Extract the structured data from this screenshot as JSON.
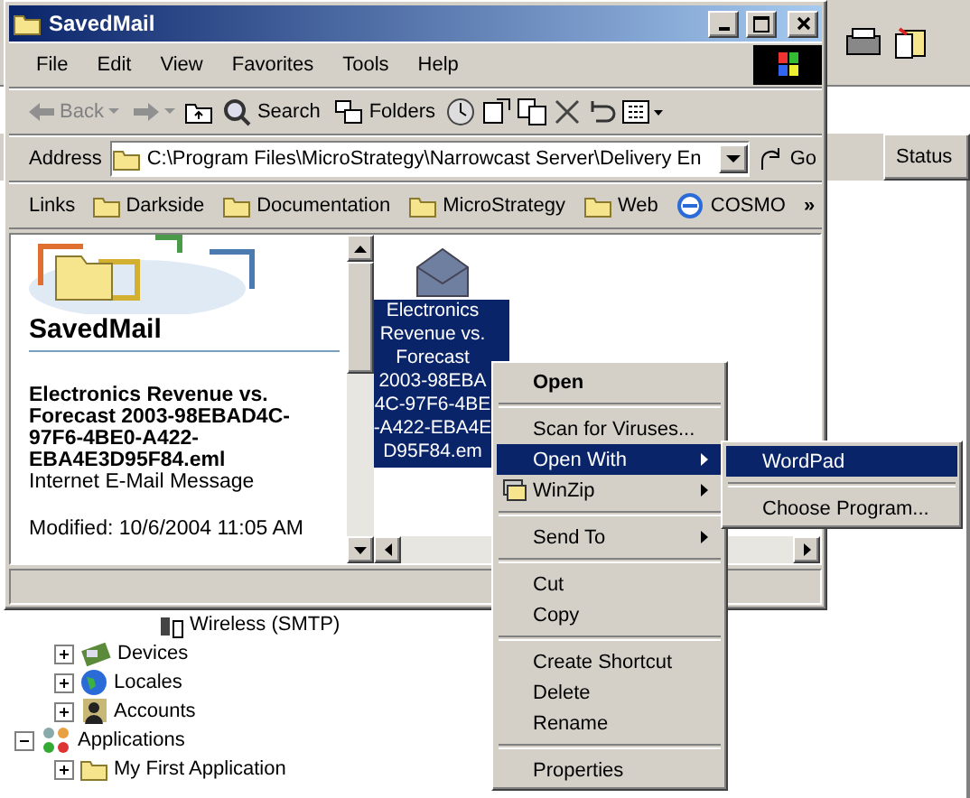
{
  "window": {
    "title": "SavedMail"
  },
  "menu": [
    "File",
    "Edit",
    "View",
    "Favorites",
    "Tools",
    "Help"
  ],
  "toolbar": {
    "back": "Back",
    "search": "Search",
    "folders": "Folders"
  },
  "address": {
    "label": "Address",
    "value": "C:\\Program Files\\MicroStrategy\\Narrowcast Server\\Delivery En",
    "go": "Go"
  },
  "links": {
    "label": "Links",
    "more": "»",
    "items": [
      {
        "label": "Darkside",
        "kind": "folder"
      },
      {
        "label": "Documentation",
        "kind": "folder"
      },
      {
        "label": "MicroStrategy",
        "kind": "folder"
      },
      {
        "label": "Web",
        "kind": "folder"
      },
      {
        "label": "COSMO",
        "kind": "web"
      }
    ]
  },
  "info_panel": {
    "title": "SavedMail",
    "file_name": "Electronics Revenue vs. Forecast 2003-98EBAD4C-97F6-4BE0-A422-EBA4E3D95F84.eml",
    "file_type": "Internet E-Mail Message",
    "modified": "Modified: 10/6/2004 11:05 AM"
  },
  "file": {
    "selected": true,
    "label_lines": [
      "Electronics",
      "Revenue vs.",
      "Forecast",
      "2003-98EBA",
      "4C-97F6-4BE",
      "-A422-EBA4E",
      "D95F84.em"
    ]
  },
  "context_menu": [
    {
      "kind": "item",
      "label": "Open",
      "default": true,
      "selected": false
    },
    {
      "kind": "separator"
    },
    {
      "kind": "item",
      "label": "Scan for Viruses...",
      "selected": false
    },
    {
      "kind": "item",
      "label": "Open With",
      "submenu": true,
      "selected": true
    },
    {
      "kind": "item",
      "label": "WinZip",
      "submenu": true,
      "icon": true,
      "selected": false
    },
    {
      "kind": "separator"
    },
    {
      "kind": "item",
      "label": "Send To",
      "submenu": true,
      "selected": false
    },
    {
      "kind": "separator"
    },
    {
      "kind": "item",
      "label": "Cut",
      "selected": false
    },
    {
      "kind": "item",
      "label": "Copy",
      "selected": false
    },
    {
      "kind": "separator"
    },
    {
      "kind": "item",
      "label": "Create Shortcut",
      "selected": false
    },
    {
      "kind": "item",
      "label": "Delete",
      "selected": false
    },
    {
      "kind": "item",
      "label": "Rename",
      "selected": false
    },
    {
      "kind": "separator"
    },
    {
      "kind": "item",
      "label": "Properties",
      "selected": false
    }
  ],
  "submenu": [
    {
      "kind": "item",
      "label": "WordPad",
      "selected": true
    },
    {
      "kind": "separator"
    },
    {
      "kind": "item",
      "label": "Choose Program...",
      "selected": false
    }
  ],
  "background": {
    "column_header": "Status",
    "tree": [
      {
        "children": [
          {
            "children": [
              {
                "label": "Wireless (SMTP)",
                "kind": "wireless"
              }
            ]
          },
          {
            "label": "Devices",
            "kind": "device",
            "expanded": false
          },
          {
            "label": "Locales",
            "kind": "globe",
            "expanded": false
          },
          {
            "label": "Accounts",
            "kind": "person",
            "expanded": false
          }
        ]
      },
      {
        "label": "Applications",
        "kind": "apps",
        "expanded": true,
        "children": [
          {
            "label": "My First Application",
            "kind": "folder",
            "expanded": false
          }
        ]
      }
    ]
  }
}
